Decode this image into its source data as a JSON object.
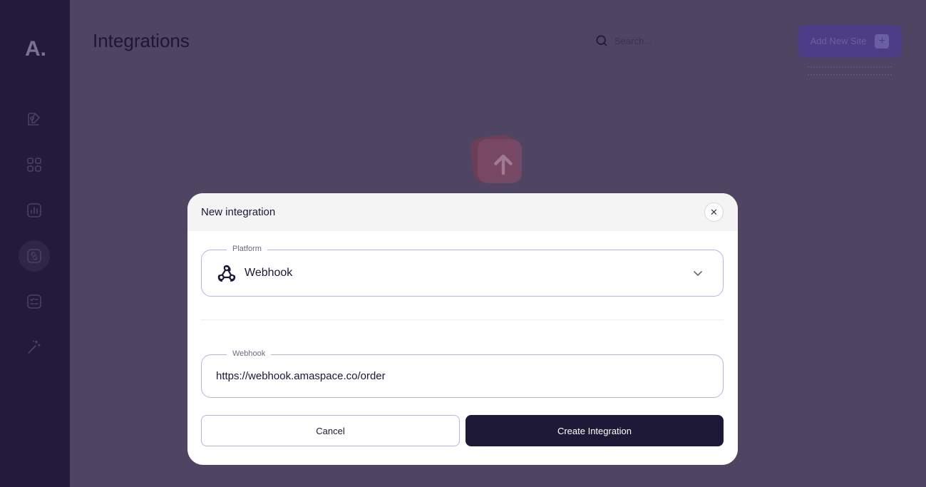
{
  "app": {
    "logo": "A."
  },
  "sidebar": {
    "items": [
      {
        "icon": "edit-image-icon",
        "active": false
      },
      {
        "icon": "grid-icon",
        "active": false
      },
      {
        "icon": "chart-icon",
        "active": false
      },
      {
        "icon": "integration-icon",
        "active": true
      },
      {
        "icon": "checklist-icon",
        "active": false
      },
      {
        "icon": "magic-wand-icon",
        "active": false
      }
    ]
  },
  "header": {
    "title": "Integrations",
    "search_placeholder": "Search...",
    "add_button_label": "Add New Site",
    "add_button_icon": "plus-icon"
  },
  "modal": {
    "title": "New integration",
    "close_icon": "close-icon",
    "platform": {
      "label": "Platform",
      "value": "Webhook",
      "icon": "webhook-icon",
      "dropdown_icon": "chevron-down-icon"
    },
    "webhook": {
      "label": "Webhook",
      "value": "https://webhook.amaspace.co/order"
    },
    "cancel_label": "Cancel",
    "create_label": "Create Integration"
  },
  "colors": {
    "sidebar_bg": "#231b3c",
    "overlay_bg": "#4f4563",
    "primary_dark": "#1e1937",
    "accent_border": "#b9b2de",
    "add_button": "#4c3d86"
  }
}
